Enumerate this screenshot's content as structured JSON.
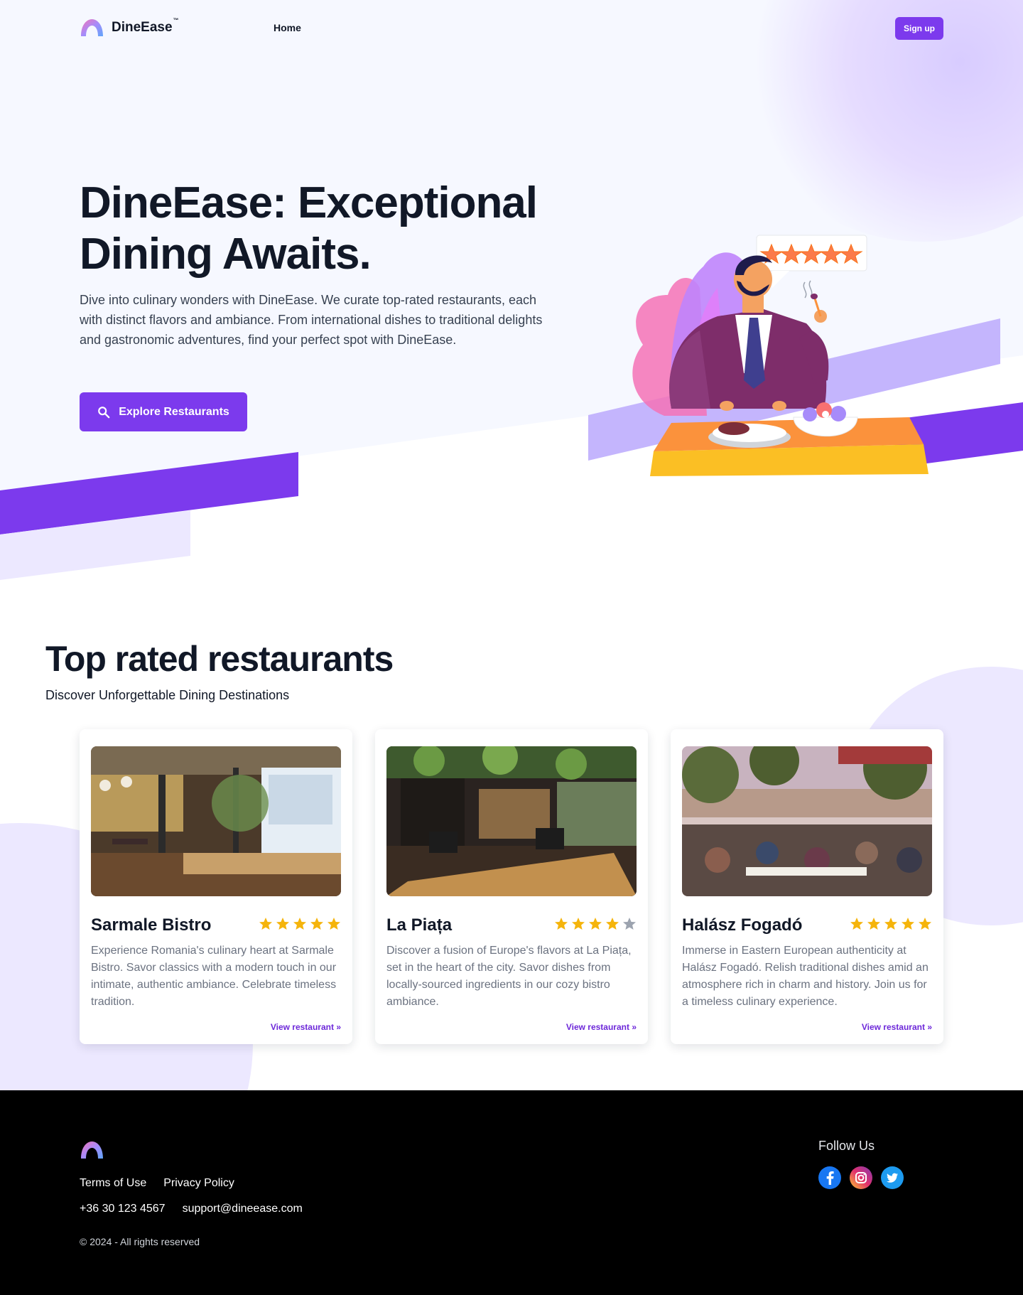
{
  "nav": {
    "brand": "DineEase",
    "trademark": "™",
    "home": "Home",
    "signup": "Sign up"
  },
  "hero": {
    "title": "DineEase: Exceptional Dining Awaits.",
    "description": "Dive into culinary wonders with DineEase. We curate top-rated restaurants, each with distinct flavors and ambiance. From international dishes to traditional delights and gastronomic adventures, find your perfect spot with DineEase.",
    "cta": "Explore Restaurants"
  },
  "restaurants": {
    "title": "Top rated restaurants",
    "subtitle": "Discover Unforgettable Dining Destinations",
    "items": [
      {
        "name": "Sarmale Bistro",
        "rating": 5,
        "description": "Experience Romania's culinary heart at Sarmale Bistro. Savor classics with a modern touch in our intimate, authentic ambiance. Celebrate timeless tradition.",
        "link": "View restaurant »"
      },
      {
        "name": "La Piața",
        "rating": 4,
        "description": "Discover a fusion of Europe's flavors at La Piața, set in the heart of the city. Savor dishes from locally-sourced ingredients in our cozy bistro ambiance.",
        "link": "View restaurant »"
      },
      {
        "name": "Halász Fogadó",
        "rating": 5,
        "description": "Immerse in Eastern European authenticity at Halász Fogadó. Relish traditional dishes amid an atmosphere rich in charm and history. Join us for a timeless culinary experience.",
        "link": "View restaurant »"
      }
    ]
  },
  "footer": {
    "terms": "Terms of Use",
    "privacy": "Privacy Policy",
    "phone": "+36 30 123 4567",
    "email": "support@dineease.com",
    "copyright": "© 2024 - All rights reserved",
    "follow": "Follow Us"
  },
  "colors": {
    "accent": "#7c3aed",
    "star_filled": "#f5b40b",
    "star_empty": "#9ca3af",
    "footer_bg": "#000000"
  },
  "icons": [
    "logo-icon",
    "search-icon",
    "star-icon",
    "facebook-icon",
    "instagram-icon",
    "twitter-icon"
  ]
}
